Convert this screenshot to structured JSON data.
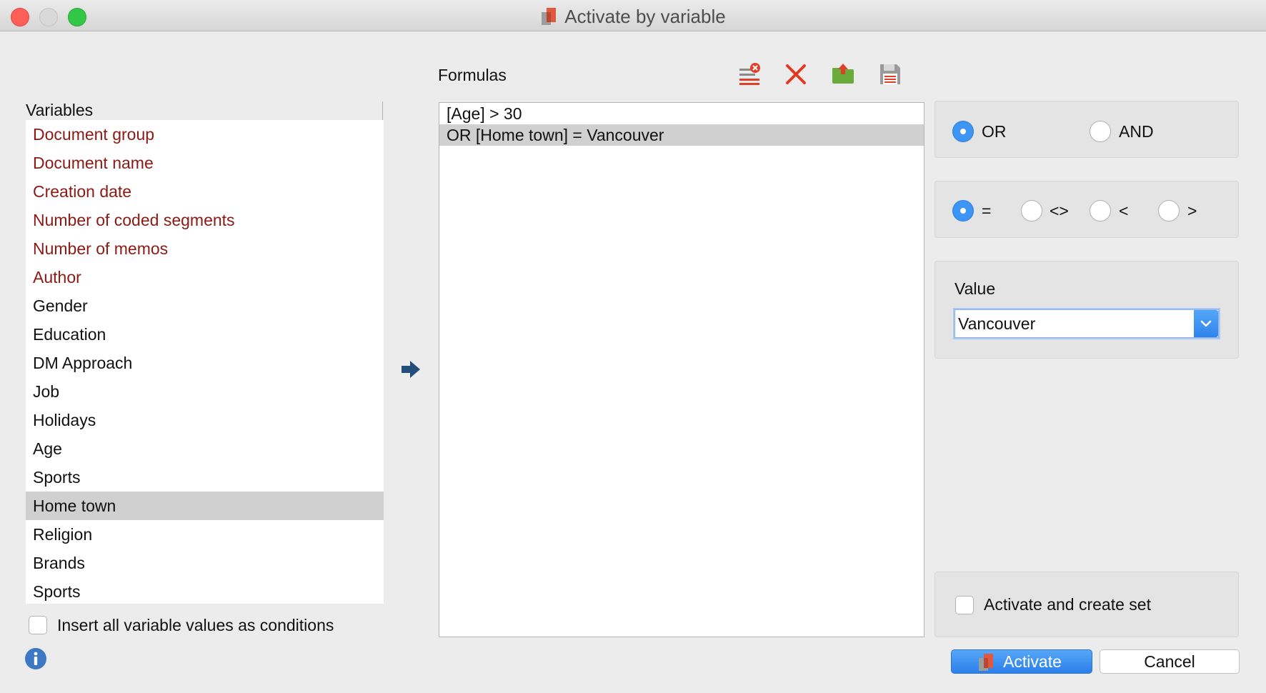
{
  "window": {
    "title": "Activate by variable"
  },
  "variables": {
    "header": "Variables",
    "items": [
      {
        "label": "Document group",
        "kind": "system"
      },
      {
        "label": "Document name",
        "kind": "system"
      },
      {
        "label": "Creation date",
        "kind": "system"
      },
      {
        "label": "Number of coded segments",
        "kind": "system"
      },
      {
        "label": "Number of memos",
        "kind": "system"
      },
      {
        "label": "Author",
        "kind": "system"
      },
      {
        "label": "Gender",
        "kind": "user"
      },
      {
        "label": "Education",
        "kind": "user"
      },
      {
        "label": "DM Approach",
        "kind": "user"
      },
      {
        "label": "Job",
        "kind": "user"
      },
      {
        "label": "Holidays",
        "kind": "user"
      },
      {
        "label": "Age",
        "kind": "user"
      },
      {
        "label": "Sports",
        "kind": "user"
      },
      {
        "label": "Home town",
        "kind": "user",
        "selected": true
      },
      {
        "label": "Religion",
        "kind": "user"
      },
      {
        "label": "Brands",
        "kind": "user"
      },
      {
        "label": "Sports",
        "kind": "user"
      }
    ],
    "insert_all_label": "Insert all variable values as conditions",
    "insert_all_checked": false
  },
  "formulas": {
    "label": "Formulas",
    "toolbar_icons": [
      "clear-list-icon",
      "delete-icon",
      "load-icon",
      "save-icon"
    ],
    "items": [
      {
        "text": "[Age] > 30",
        "selected": false
      },
      {
        "text": "OR [Home town] = Vancouver",
        "selected": true
      }
    ]
  },
  "logic": {
    "or_label": "OR",
    "and_label": "AND",
    "selected": "OR"
  },
  "operators": {
    "options": [
      "=",
      "<>",
      "<",
      ">"
    ],
    "selected": "="
  },
  "value": {
    "label": "Value",
    "current": "Vancouver"
  },
  "set_option": {
    "label": "Activate and create set",
    "checked": false
  },
  "buttons": {
    "activate": "Activate",
    "cancel": "Cancel"
  },
  "colors": {
    "system_variable": "#8b1a14",
    "accent": "#3d95f5",
    "selection": "#d0d0d0"
  }
}
